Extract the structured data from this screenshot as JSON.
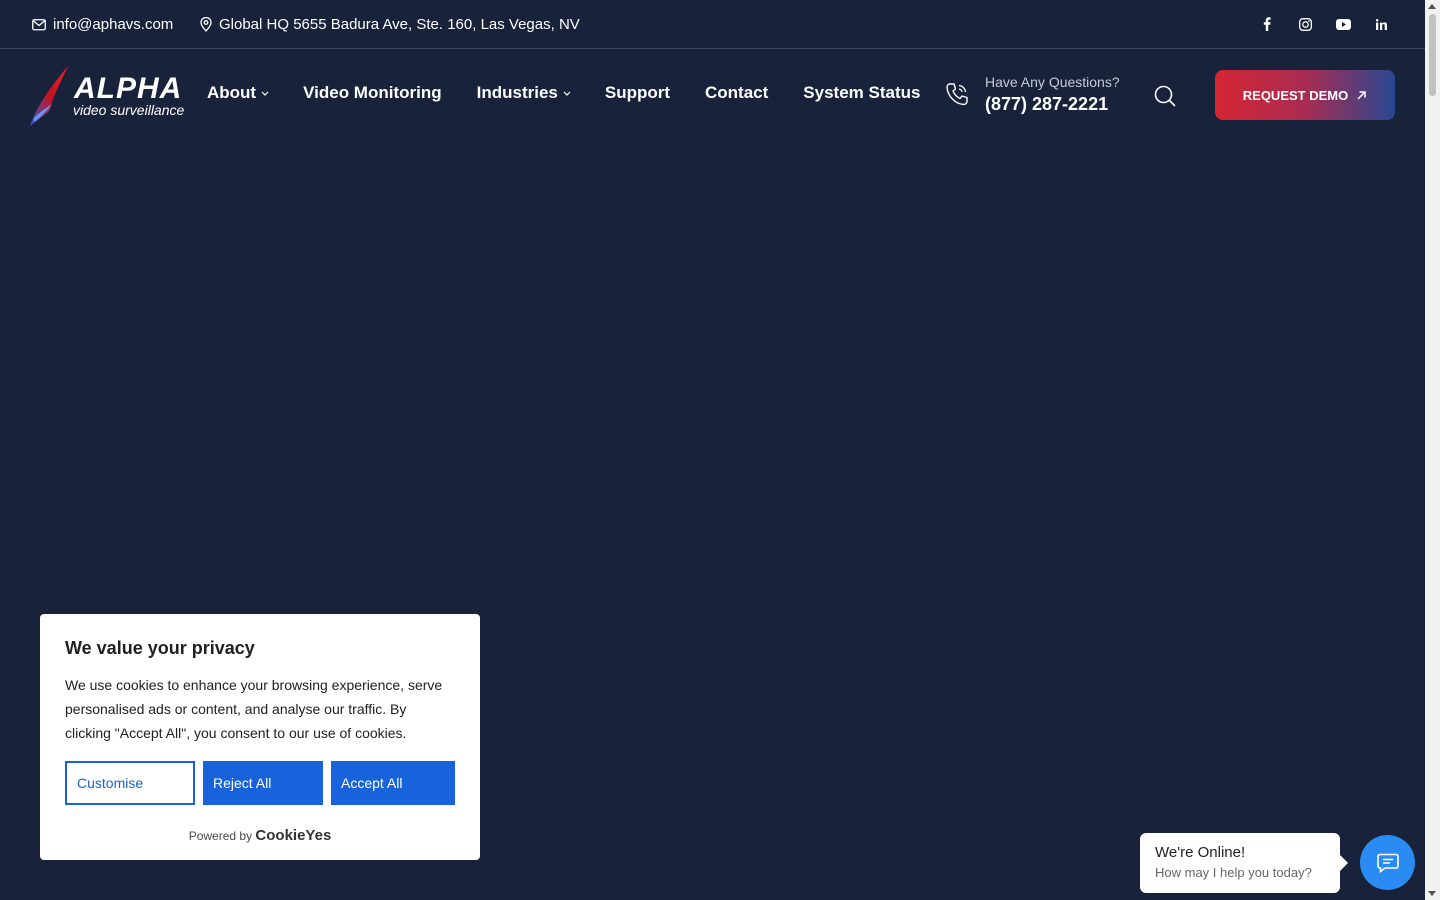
{
  "topbar": {
    "email": "info@aphavs.com",
    "address": "Global HQ 5655 Badura Ave, Ste. 160, Las Vegas, NV",
    "socials": [
      "facebook-icon",
      "instagram-icon",
      "youtube-icon",
      "linkedin-icon"
    ]
  },
  "logo": {
    "brand": "ALPHA",
    "tagline": "video surveillance"
  },
  "nav": {
    "items": [
      {
        "label": "About",
        "dropdown": true
      },
      {
        "label": "Video Monitoring",
        "dropdown": false
      },
      {
        "label": "Industries",
        "dropdown": true
      },
      {
        "label": "Support",
        "dropdown": false
      },
      {
        "label": "Contact",
        "dropdown": false
      },
      {
        "label": "System Status",
        "dropdown": false
      }
    ],
    "question": "Have Any Questions?",
    "phone": "(877) 287-2221",
    "demo_label": "REQUEST DEMO"
  },
  "cookie": {
    "title": "We value your privacy",
    "body": "We use cookies to enhance your browsing experience, serve personalised ads or content, and analyse our traffic. By clicking \"Accept All\", you consent to our use of cookies.",
    "customise": "Customise",
    "reject": "Reject All",
    "accept": "Accept All",
    "powered_by": "Powered by",
    "powered_brand": "CookieYes"
  },
  "chat": {
    "title": "We're Online!",
    "subtitle": "How may I help you today?"
  },
  "colors": {
    "background": "#18223a",
    "accent_blue": "#1863dc",
    "demo_gradient_start": "#d42533",
    "demo_gradient_end": "#284892",
    "chat_button": "#2a8bf2"
  }
}
